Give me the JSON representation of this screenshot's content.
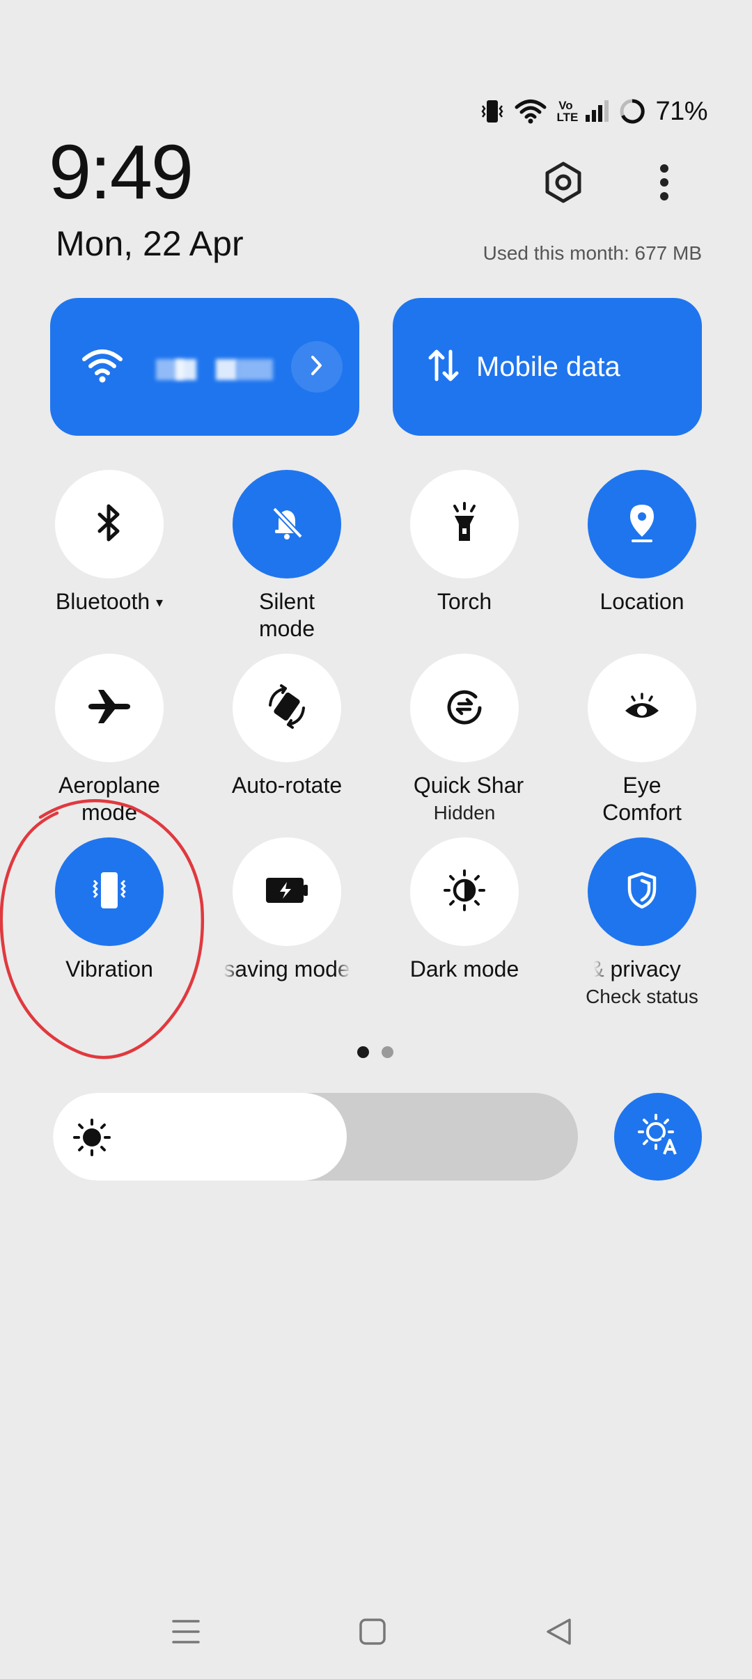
{
  "status_bar": {
    "battery": "71%",
    "icons": [
      "vibrate-icon",
      "wifi-icon",
      "volte-icon",
      "signal-icon",
      "battery-ring-icon"
    ],
    "volte_text_top": "Vo",
    "volte_text_bottom": "LTE"
  },
  "header": {
    "time": "9:49",
    "date": "Mon, 22 Apr",
    "usage": "Used this month: 677 MB"
  },
  "tiles": {
    "wifi": {
      "icon": "wifi-icon"
    },
    "mobile_data": {
      "label": "Mobile data",
      "icon": "data-arrows-icon"
    }
  },
  "toggles": [
    {
      "label": "Bluetooth",
      "active": false
    },
    {
      "label_line1": "Silent",
      "label_line2": "mode",
      "active": true
    },
    {
      "label": "Torch",
      "active": false
    },
    {
      "label": "Location",
      "active": true
    },
    {
      "label_line1": "Aeroplane",
      "label_line2": "mode",
      "active": false
    },
    {
      "label": "Auto-rotate",
      "active": false
    },
    {
      "label": "Quick Shar",
      "sub": "Hidden",
      "active": false
    },
    {
      "label_line1": "Eye",
      "label_line2": "Comfort",
      "active": false
    },
    {
      "label": "Vibration",
      "active": true
    },
    {
      "label": "saving mode",
      "active": false
    },
    {
      "label": "Dark mode",
      "active": false
    },
    {
      "label": "& privacy",
      "sub": "Check status",
      "active": true
    }
  ],
  "pager": {
    "pages": 2,
    "current": 1
  },
  "brightness": {
    "level": 0.56
  },
  "colors": {
    "accent": "#1f75ee",
    "background": "#ebebeb",
    "annotation": "#e0393e"
  }
}
